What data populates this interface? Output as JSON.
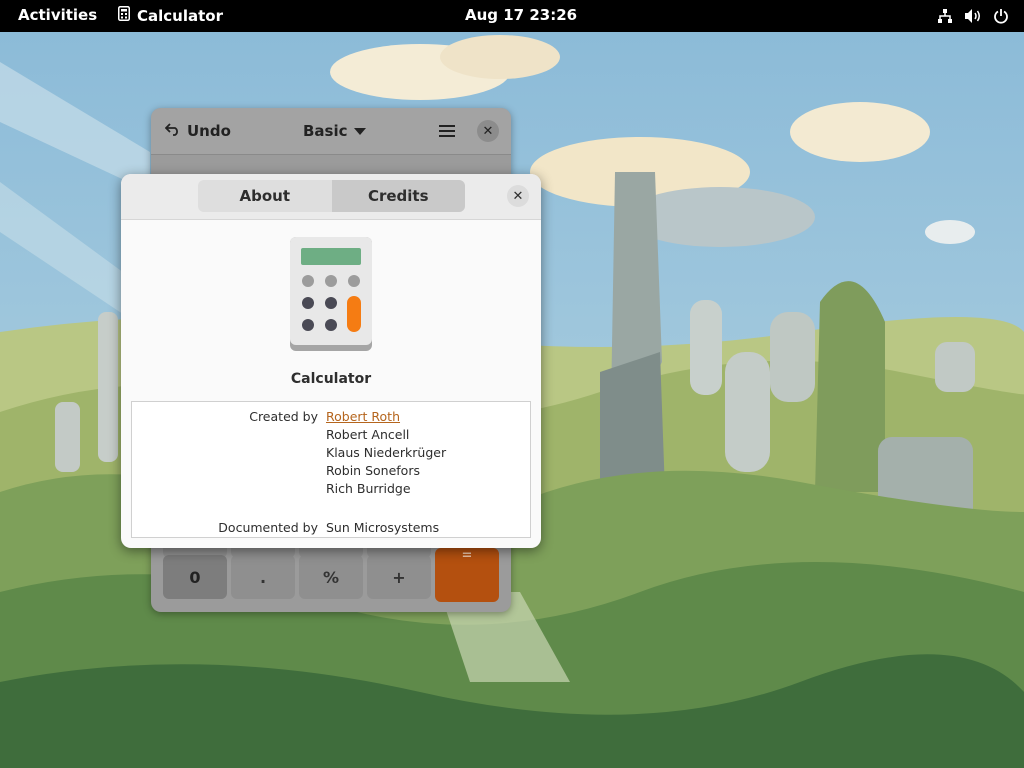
{
  "topbar": {
    "activities": "Activities",
    "app_name": "Calculator",
    "clock": "Aug 17  23:26",
    "tray_icons": [
      "network-icon",
      "volume-icon",
      "power-icon"
    ]
  },
  "calculator": {
    "undo_label": "Undo",
    "mode_label": "Basic",
    "bottom_row": [
      "0",
      ".",
      "%",
      "+"
    ],
    "equals_label": "="
  },
  "about": {
    "tabs": [
      {
        "label": "About",
        "active": false
      },
      {
        "label": "Credits",
        "active": true
      }
    ],
    "app_name": "Calculator",
    "credits": {
      "created_by_label": "Created by",
      "authors": [
        "Robert Roth",
        "Robert Ancell",
        "Klaus Niederkrüger",
        "Robin Sonefors",
        "Rich Burridge"
      ],
      "documented_by_label": "Documented by",
      "documenters": [
        "Sun Microsystems"
      ]
    }
  },
  "colors": {
    "accent": "#b5651d",
    "equals_button": "#b4500f",
    "topbar": "#000000"
  }
}
